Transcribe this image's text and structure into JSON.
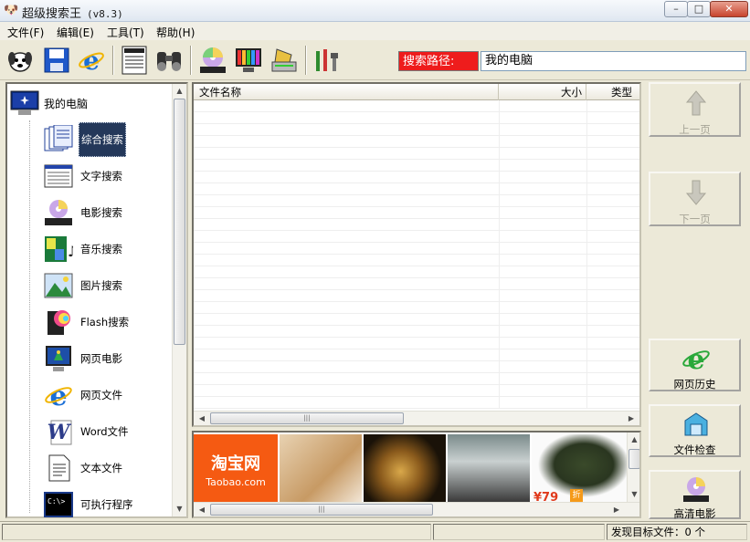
{
  "window": {
    "title": "超级搜索王",
    "version": "(v8.3)",
    "minimize_glyph": "–",
    "maximize_glyph": "□",
    "close_glyph": "✕"
  },
  "menu": [
    {
      "label": "文件(F)"
    },
    {
      "label": "编辑(E)"
    },
    {
      "label": "工具(T)"
    },
    {
      "label": "帮助(H)"
    }
  ],
  "toolbar": {
    "icons": [
      "dog-mascot-icon",
      "save-disk-icon",
      "ie-browser-icon",
      "top-list-icon",
      "binoculars-icon",
      "movie-disc-icon",
      "monitor-icon",
      "scanner-icon",
      "tools-icon"
    ],
    "path_label": "搜索路径:",
    "path_value": "我的电脑"
  },
  "tree": {
    "root_label": "我的电脑",
    "items": [
      {
        "label": "综合搜索",
        "icon": "combined-search-icon",
        "selected": true
      },
      {
        "label": "文字搜索",
        "icon": "text-search-icon"
      },
      {
        "label": "电影搜索",
        "icon": "movie-search-icon"
      },
      {
        "label": "音乐搜索",
        "icon": "music-search-icon"
      },
      {
        "label": "图片搜索",
        "icon": "picture-search-icon"
      },
      {
        "label": "Flash搜索",
        "icon": "flash-search-icon"
      },
      {
        "label": "网页电影",
        "icon": "web-movie-icon"
      },
      {
        "label": "网页文件",
        "icon": "web-file-icon"
      },
      {
        "label": "Word文件",
        "icon": "word-file-icon"
      },
      {
        "label": "文本文件",
        "icon": "text-file-icon"
      },
      {
        "label": "可执行程序",
        "icon": "executable-icon"
      }
    ]
  },
  "filelist": {
    "columns": [
      {
        "label": "文件名称"
      },
      {
        "label": "大小"
      },
      {
        "label": "类型"
      }
    ],
    "rows": []
  },
  "ad": {
    "taobao_cn": "淘宝网",
    "taobao_en": "Taobao.com",
    "price": "¥79",
    "discount": "折"
  },
  "right_buttons": {
    "prev_page": "上一页",
    "next_page": "下一页",
    "web_history": "网页历史",
    "file_check": "文件检查",
    "hd_movie": "高清电影"
  },
  "status": {
    "found": "发现目标文件：0 个"
  },
  "colors": {
    "path_label_bg": "#ee1c1c",
    "selected_bg": "#24385a",
    "taobao_orange": "#f55a12"
  }
}
